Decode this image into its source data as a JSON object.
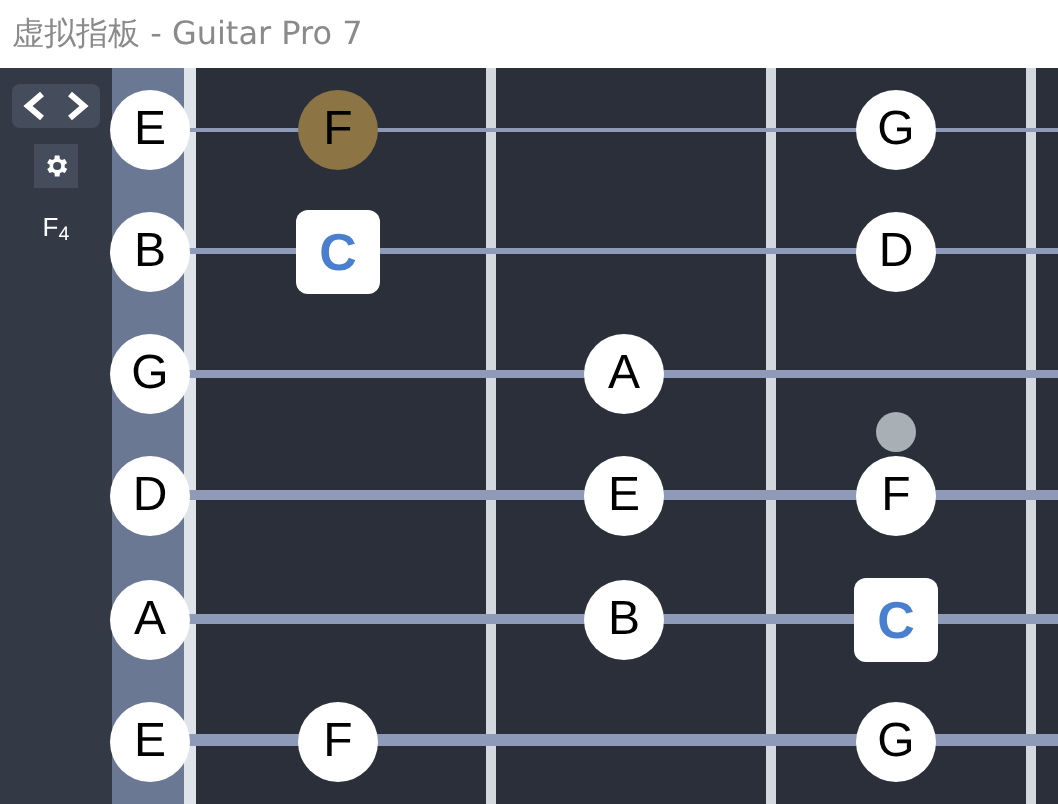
{
  "window": {
    "title": "虚拟指板 - Guitar Pro 7"
  },
  "sidebar": {
    "current_note": "F$_{4}$"
  },
  "strings": [
    {
      "frets": [
        {
          "kind": "note",
          "label": "E",
          "selected": false
        },
        {
          "kind": "note",
          "label": "F",
          "selected": true
        },
        {
          "kind": "empty"
        },
        {
          "kind": "note",
          "label": "G",
          "selected": false
        }
      ]
    },
    {
      "frets": [
        {
          "kind": "note",
          "label": "B",
          "selected": false
        },
        {
          "kind": "root",
          "label": "C",
          "selected": false
        },
        {
          "kind": "empty"
        },
        {
          "kind": "note",
          "label": "D",
          "selected": false
        }
      ]
    },
    {
      "frets": [
        {
          "kind": "note",
          "label": "G",
          "selected": false
        },
        {
          "kind": "empty"
        },
        {
          "kind": "note",
          "label": "A",
          "selected": false
        },
        {
          "kind": "empty"
        }
      ]
    },
    {
      "frets": [
        {
          "kind": "note",
          "label": "D",
          "selected": false
        },
        {
          "kind": "empty"
        },
        {
          "kind": "note",
          "label": "E",
          "selected": false
        },
        {
          "kind": "note",
          "label": "F",
          "selected": false
        }
      ]
    },
    {
      "frets": [
        {
          "kind": "note",
          "label": "A",
          "selected": false
        },
        {
          "kind": "empty"
        },
        {
          "kind": "note",
          "label": "B",
          "selected": false
        },
        {
          "kind": "root",
          "label": "C",
          "selected": false
        }
      ]
    },
    {
      "frets": [
        {
          "kind": "note",
          "label": "E",
          "selected": false
        },
        {
          "kind": "note",
          "label": "F",
          "selected": false
        },
        {
          "kind": "empty"
        },
        {
          "kind": "note",
          "label": "G",
          "selected": false
        }
      ]
    }
  ]
}
